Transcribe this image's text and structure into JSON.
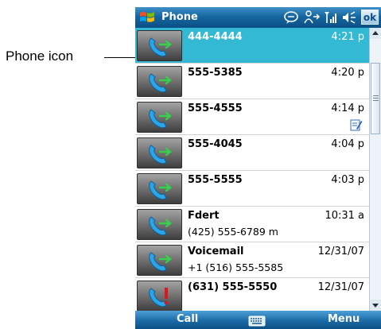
{
  "callout": {
    "label": "Phone icon"
  },
  "titlebar": {
    "title": "Phone",
    "ok_label": "ok"
  },
  "calls": [
    {
      "name": "444-4444",
      "time": "4:21 p",
      "sub": "",
      "selected": true
    },
    {
      "name": "555-5385",
      "time": "4:20 p",
      "sub": ""
    },
    {
      "name": "555-4555",
      "time": "4:14 p",
      "sub": "",
      "note_icon": "note-icon"
    },
    {
      "name": "555-4045",
      "time": "4:04 p",
      "sub": ""
    },
    {
      "name": "555-5555",
      "time": "4:03 p",
      "sub": ""
    },
    {
      "name": "Fdert",
      "time": "10:31 a",
      "sub": "(425) 555-6789 m"
    },
    {
      "name": "Voicemail",
      "time": "12/31/07",
      "sub": "+1 (516) 555-5585"
    },
    {
      "name": "(631) 555-5550",
      "time": "12/31/07",
      "sub": "",
      "missed": true
    }
  ],
  "softkeys": {
    "left": "Call",
    "right": "Menu"
  },
  "colors": {
    "titlebar": "#16669f",
    "selected_row": "#34b9d4",
    "missed_mark": "#e0141a"
  }
}
